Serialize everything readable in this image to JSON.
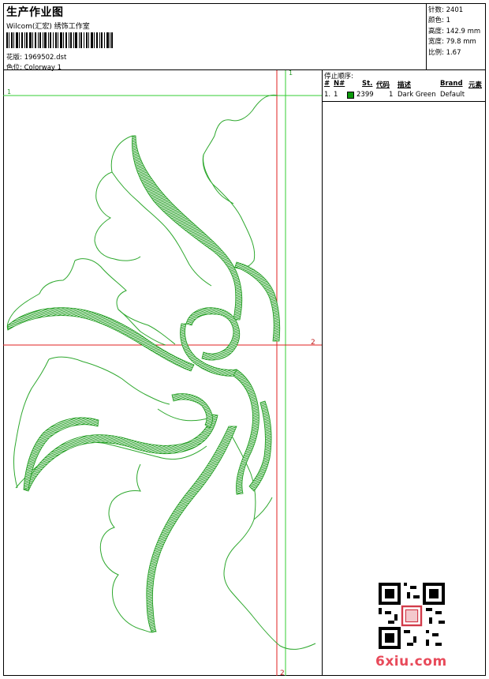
{
  "header": {
    "title": "生产作业图",
    "company": "Wilcom(汇宏) 绣饰工作室",
    "design_line": "花版: 1969502.dst",
    "colorway_line": "色位: Colorway 1"
  },
  "stats": [
    "针数: 2401",
    "颜色: 1",
    "高度: 142.9 mm",
    "宽度: 79.8 mm",
    "比例: 1.67"
  ],
  "stop_sequence": {
    "title": "停止顺序:",
    "columns": [
      "#",
      "N#",
      "St.",
      "代码",
      "描述",
      "Brand",
      "元素"
    ],
    "rows": [
      {
        "index": "1.",
        "n": "1",
        "stitches": "2399",
        "code": "1",
        "description": "Dark Green",
        "brand": "Default",
        "color": "#0a9a0a"
      }
    ]
  },
  "guides": {
    "green_top_label": "1",
    "green_left_label": "1",
    "red_right_label": "2",
    "red_bottom_label": "2"
  },
  "colors": {
    "stitch": "#1a9a1a",
    "outline": "#2ea82e",
    "red_guide": "#e02020",
    "green_guide": "#33cc33"
  },
  "watermark": {
    "text": "6xiu.com"
  }
}
